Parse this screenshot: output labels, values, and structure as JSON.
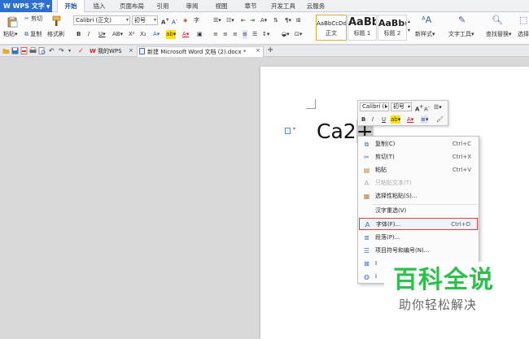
{
  "app": {
    "title": "WPS 文字",
    "accent": "#2b6fd0"
  },
  "menubar": {
    "tabs": [
      {
        "label": "开始",
        "active": true
      },
      {
        "label": "插入"
      },
      {
        "label": "页面布局"
      },
      {
        "label": "引用"
      },
      {
        "label": "审阅"
      },
      {
        "label": "视图"
      },
      {
        "label": "章节"
      },
      {
        "label": "开发工具"
      },
      {
        "label": "云服务"
      }
    ]
  },
  "ribbon": {
    "paste": "粘贴",
    "cut": "剪切",
    "copy": "复制",
    "format_painter": "格式刷",
    "font_name": "Calibri (正文)",
    "font_size": "初号",
    "styles": [
      {
        "sample": "AaBbCcDd",
        "label": "正文"
      },
      {
        "sample": "AaBb",
        "label": "标题 1"
      },
      {
        "sample": "AaBb(",
        "label": "标题 2"
      }
    ],
    "new_style": "新样式",
    "text_tools": "文字工具",
    "find_replace": "查找替换",
    "select": "选择"
  },
  "tabbar": {
    "tabs": [
      {
        "label": "我的WPS",
        "active": false
      },
      {
        "label": "新建 Microsoft Word 文档 (2).docx *",
        "active": true
      }
    ],
    "close_symbol": "×",
    "new_tab_symbol": "+"
  },
  "document": {
    "text_before": "Ca2",
    "text_selected": "+"
  },
  "mini_toolbar": {
    "font_name": "Calibri (I",
    "font_size": "初号"
  },
  "context_menu": {
    "items": [
      {
        "icon": "copy-icon",
        "label": "复制(C)",
        "shortcut": "Ctrl+C",
        "enabled": true
      },
      {
        "icon": "cut-icon",
        "label": "剪切(T)",
        "shortcut": "Ctrl+X",
        "enabled": true
      },
      {
        "icon": "paste-icon",
        "label": "粘贴",
        "shortcut": "Ctrl+V",
        "enabled": true
      },
      {
        "icon": "paste-text-icon",
        "label": "只粘贴文本(T)",
        "shortcut": "",
        "enabled": false
      },
      {
        "icon": "paste-special-icon",
        "label": "选择性粘贴(S)...",
        "shortcut": "",
        "enabled": true
      },
      {
        "icon": "",
        "label": "汉字重选(V)",
        "shortcut": "",
        "enabled": true
      },
      {
        "icon": "font-icon",
        "label": "字体(F)...",
        "shortcut": "Ctrl+D",
        "enabled": true,
        "highlighted": true
      },
      {
        "icon": "paragraph-icon",
        "label": "段落(P)...",
        "shortcut": "",
        "enabled": true
      },
      {
        "icon": "bullets-icon",
        "label": "项目符号和编号(N)...",
        "shortcut": "",
        "enabled": true
      },
      {
        "icon": "picture-icon",
        "label": "I",
        "shortcut": "",
        "enabled": true
      },
      {
        "icon": "translate-icon",
        "label": "i",
        "shortcut": "",
        "enabled": true
      }
    ]
  },
  "watermark": {
    "title": "百科全说",
    "subtitle": "助你轻松解决",
    "color": "#2fbf4c"
  }
}
